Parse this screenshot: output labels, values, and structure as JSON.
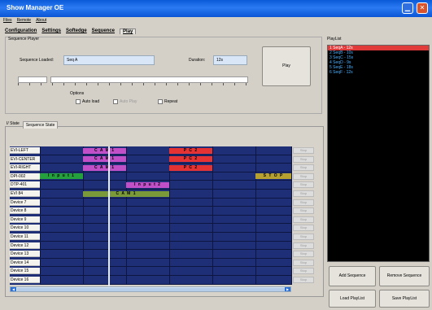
{
  "window": {
    "title": "Show Manager OE",
    "min_glyph": "▁",
    "close_glyph": "✕"
  },
  "menu": [
    "Files",
    "Remote",
    "About"
  ],
  "tabs": [
    "Configuration",
    "Settings",
    "Softedge",
    "Sequence",
    "Play"
  ],
  "sequence_player": {
    "group_label": "Sequence Player",
    "loaded_label": "Sequence Loaded:",
    "loaded_value": "Seq A",
    "duration_label": "Duration:",
    "duration_value": "12s",
    "play_label": "Play",
    "options_label": "Options",
    "auto_load_label": "Auto load",
    "auto_play_label": "Auto Play",
    "repeat_label": "Repeat"
  },
  "subtabs": [
    "I/ State",
    "Sequence State"
  ],
  "timeline": {
    "rows": [
      "EVI-LEFT",
      "EVI-CENTER",
      "EVI-RIGHT",
      "DPI-002",
      "DTP-401",
      "EVI 84",
      "Device 7",
      "Device 8",
      "Device 9",
      "Device 10",
      "Device 11",
      "Device 12",
      "Device 13",
      "Device 14",
      "Device 15",
      "Device 16"
    ],
    "cues": [
      {
        "row": 0,
        "label": "C A M 1",
        "color": "#c04fc8"
      },
      {
        "row": 1,
        "label": "C A M 1",
        "color": "#c04fc8"
      },
      {
        "row": 2,
        "label": "C A M 1",
        "color": "#c04fc8"
      },
      {
        "row": 0,
        "label": "P C 2",
        "color": "#e53232"
      },
      {
        "row": 1,
        "label": "P C 2",
        "color": "#e53232"
      },
      {
        "row": 2,
        "label": "P C 2",
        "color": "#e53232"
      },
      {
        "row": 3,
        "label": "I n p u t   1",
        "color": "#24a03c"
      },
      {
        "row": 3,
        "label": "S T O P",
        "color": "#b5a030"
      },
      {
        "row": 4,
        "label": "I n p u t   2",
        "color": "#c04fc8"
      },
      {
        "row": 5,
        "label": "C A M 1",
        "color": "#7a9a3a"
      }
    ],
    "stop_label": "Stop"
  },
  "playlist": {
    "label": "PlayList",
    "items": [
      "1 SeqA  -  12s",
      "2 SeqB  -  10s",
      "3 SeqC  -  15s",
      "4 SeqD  -  9s",
      "5 SeqE  -  18s",
      "6 SeqF  -  12s"
    ],
    "add": "Add Sequence",
    "remove": "Remove Sequence",
    "load": "Load PlayList",
    "save": "Save PlayList"
  }
}
